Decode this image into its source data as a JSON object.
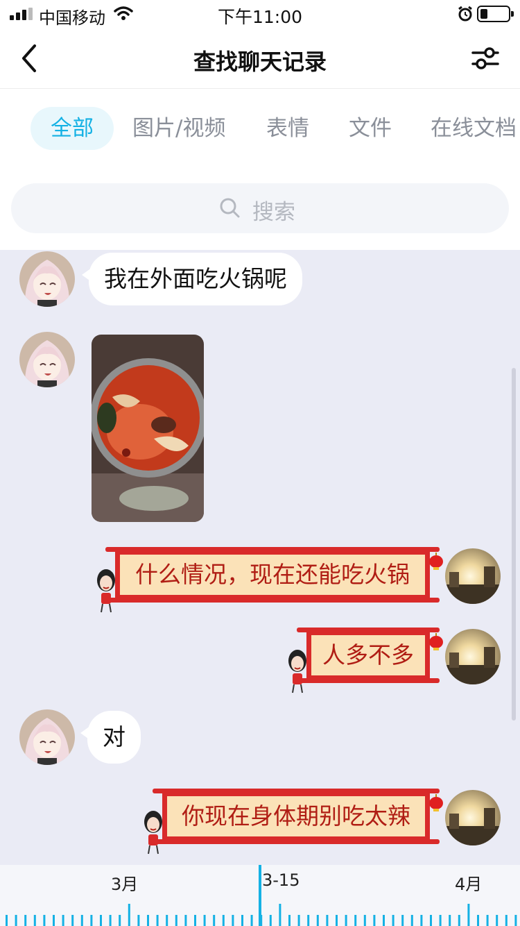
{
  "status_bar": {
    "carrier": "中国移动",
    "time": "下午11:00"
  },
  "header": {
    "title": "查找聊天记录",
    "back_icon": "chevron-left-icon",
    "filter_icon": "sliders-icon"
  },
  "tabs": [
    {
      "label": "全部",
      "active": true
    },
    {
      "label": "图片/视频",
      "active": false
    },
    {
      "label": "表情",
      "active": false
    },
    {
      "label": "文件",
      "active": false
    },
    {
      "label": "在线文档",
      "active": false
    }
  ],
  "search": {
    "placeholder": "搜索",
    "icon": "search-icon"
  },
  "messages": [
    {
      "side": "left",
      "type": "text",
      "text": "我在外面吃火锅呢"
    },
    {
      "side": "left",
      "type": "image",
      "image": "hotpot-photo"
    },
    {
      "side": "right",
      "type": "text",
      "text": "什么情况，现在还能吃火锅"
    },
    {
      "side": "right",
      "type": "text",
      "text": "人多不多"
    },
    {
      "side": "left",
      "type": "text",
      "text": "对"
    },
    {
      "side": "right",
      "type": "text",
      "text": "你现在身体期别吃太辣"
    }
  ],
  "timeline": {
    "labels": [
      "3月",
      "3-15",
      "4月"
    ],
    "current": "3-15",
    "accent": "#14b1e4"
  },
  "colors": {
    "accent": "#14b1e4",
    "chat_background": "#eaebf5",
    "scroll_bubble_text": "#b01d14",
    "scroll_bubble_border": "#d92a2a"
  }
}
